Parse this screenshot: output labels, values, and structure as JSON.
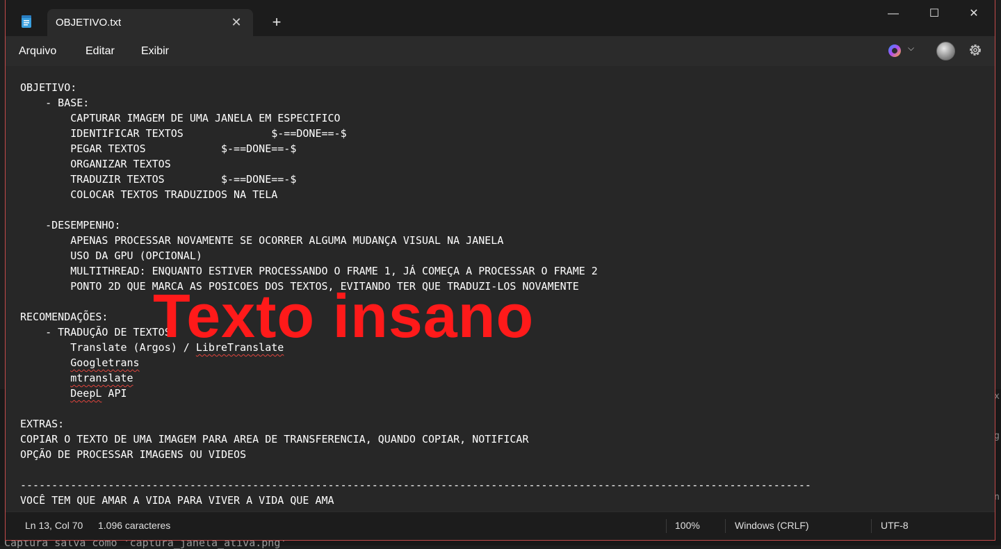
{
  "window": {
    "tab_title": "OBJETIVO.txt",
    "app_icon": "notepad-icon",
    "new_tab_symbol": "+",
    "close_symbol": "✕",
    "minimize_symbol": "—",
    "maximize_symbol": "☐",
    "window_close_symbol": "✕"
  },
  "menu": {
    "file": "Arquivo",
    "edit": "Editar",
    "view": "Exibir"
  },
  "editor": {
    "content": "OBJETIVO:\n    - BASE:\n        CAPTURAR IMAGEM DE UMA JANELA EM ESPECIFICO\n        IDENTIFICAR TEXTOS              $-==DONE==-$\n        PEGAR TEXTOS            $-==DONE==-$\n        ORGANIZAR TEXTOS\n        TRADUZIR TEXTOS         $-==DONE==-$\n        COLOCAR TEXTOS TRADUZIDOS NA TELA\n\n    -DESEMPENHO:\n        APENAS PROCESSAR NOVAMENTE SE OCORRER ALGUMA MUDANÇA VISUAL NA JANELA\n        USO DA GPU (OPCIONAL)\n        MULTITHREAD: ENQUANTO ESTIVER PROCESSANDO O FRAME 1, JÁ COMEÇA A PROCESSAR O FRAME 2\n        PONTO 2D QUE MARCA AS POSICOES DOS TEXTOS, EVITANDO TER QUE TRADUZI-LOS NOVAMENTE\n\nRECOMENDAÇÕES:\n    - TRADUÇÃO DE TEXTOS:",
    "rec_line1_prefix": "        Translate (Argos) / ",
    "rec_line1_word": "LibreTranslate",
    "rec_line2_word": "Googletrans",
    "rec_line3_word": "mtranslate",
    "rec_line4_word": "DeepL",
    "rec_line4_suffix": " API",
    "content_tail": "\n\nEXTRAS:\nCOPIAR O TEXTO DE UMA IMAGEM PARA AREA DE TRANSFERENCIA, QUANDO COPIAR, NOTIFICAR\nOPÇÃO DE PROCESSAR IMAGENS OU VIDEOS\n\n------------------------------------------------------------------------------------------------------------------------------\nVOCÊ TEM QUE AMAR A VIDA PARA VIVER A VIDA QUE AMA",
    "overlay_text": "Texto insano"
  },
  "status": {
    "position": "Ln 13, Col 70",
    "char_count": "1.096 caracteres",
    "zoom": "100%",
    "line_ending": "Windows (CRLF)",
    "encoding": "UTF-8"
  },
  "background": {
    "bottom_text": "Captura salva como 'captura_janela_ativa.png'",
    "right_glyph_1": "x",
    "right_glyph_2": "g",
    "right_glyph_3": "n"
  },
  "colors": {
    "overlay": "#ff1a1a",
    "spell_underline": "#e0443c"
  }
}
